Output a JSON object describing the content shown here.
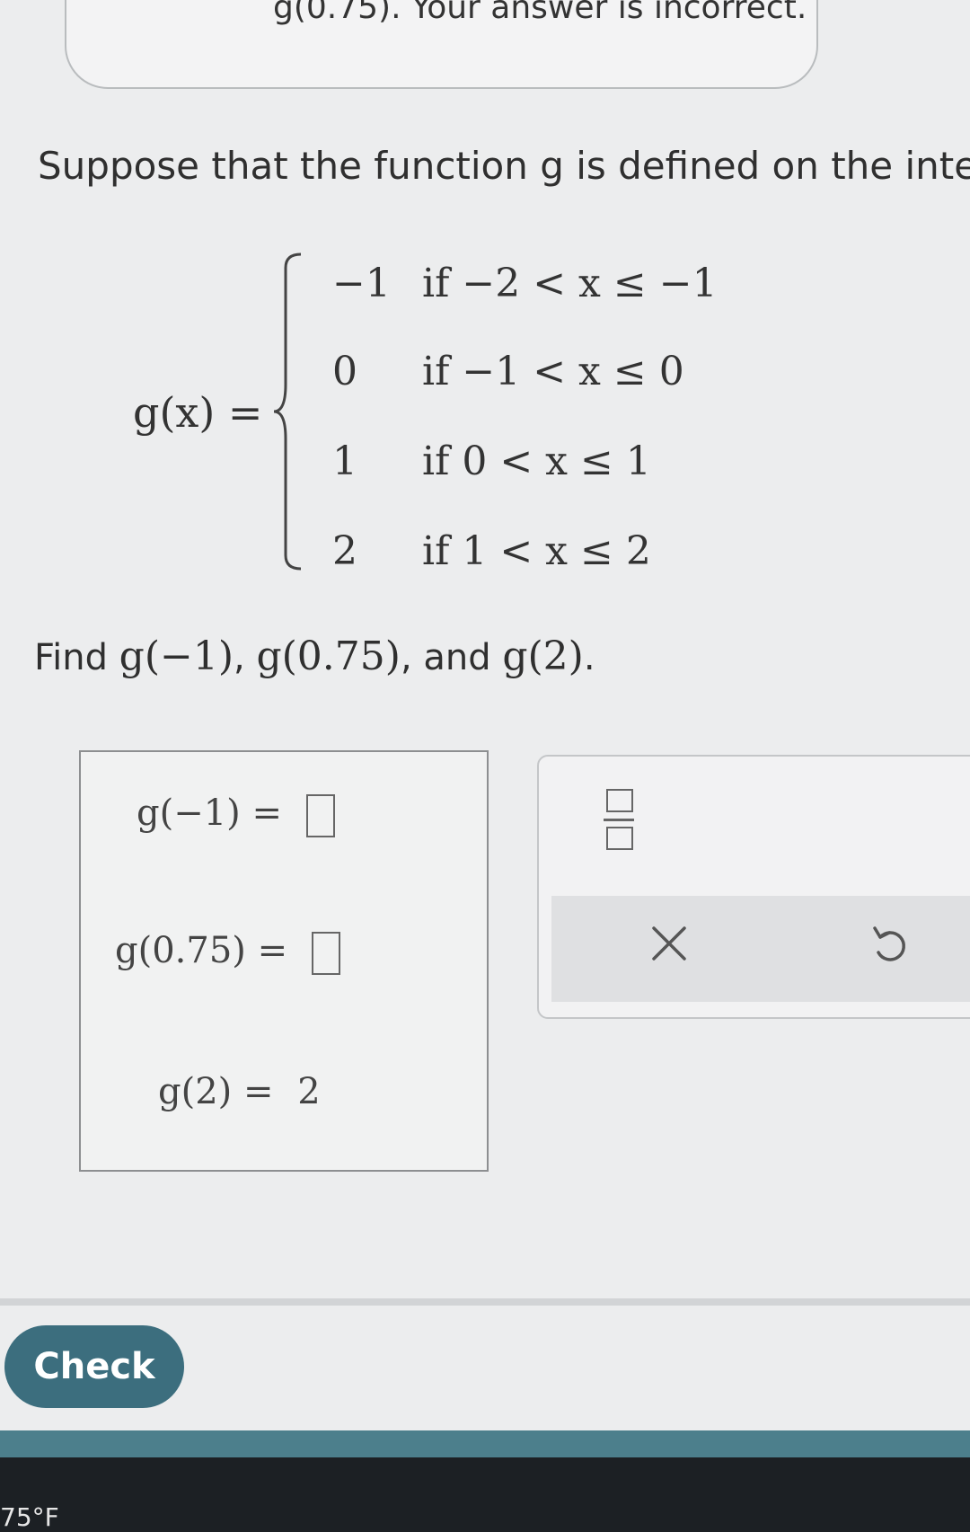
{
  "feedback": {
    "text": "g(0.75). Your answer is incorrect."
  },
  "prompt": {
    "text": "Suppose that the function g is defined on the interv"
  },
  "function_def": {
    "lhs": "g(x) =",
    "cases": [
      {
        "value": "−1",
        "condition": "if −2 < x ≤ −1"
      },
      {
        "value": "0",
        "condition": "if −1 < x ≤ 0"
      },
      {
        "value": "1",
        "condition": "if 0 < x ≤ 1"
      },
      {
        "value": "2",
        "condition": "if 1 < x ≤ 2"
      }
    ]
  },
  "question": {
    "prefix": "Find",
    "a": "g(−1)",
    "sep1": ",",
    "b": "g(0.75)",
    "sep2": ", and",
    "c": "g(2)",
    "end": "."
  },
  "answers": [
    {
      "label": "g(−1) =",
      "value": ""
    },
    {
      "label": "g(0.75) =",
      "value": ""
    },
    {
      "label": "g(2) =",
      "value": "2"
    }
  ],
  "tools": {
    "fraction": "fraction-icon",
    "clear": "×",
    "undo": "undo-icon"
  },
  "check_button": {
    "label": "Check"
  },
  "taskbar": {
    "weather": "75°F"
  }
}
